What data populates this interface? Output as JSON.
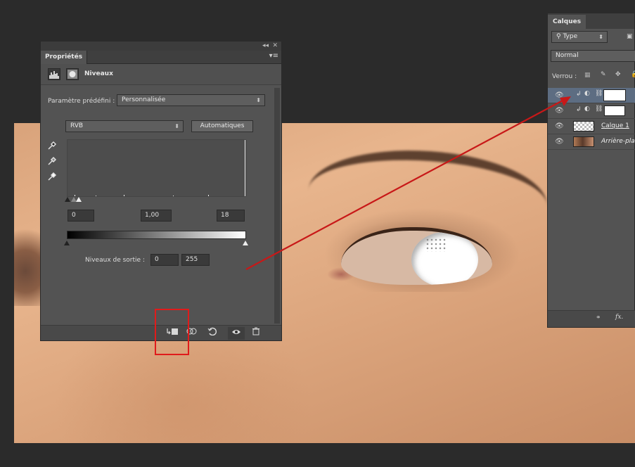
{
  "properties_panel": {
    "tab_label": "Propriétés",
    "collapse_glyph": "◂◂",
    "close_glyph": "✕",
    "menu_glyph": "▾≡",
    "adjustment_title": "Niveaux",
    "preset_label": "Paramètre prédéfini :",
    "preset_value": "Personnalisée",
    "channel_value": "RVB",
    "auto_button": "Automatiques",
    "input_black": "0",
    "input_gamma": "1,00",
    "input_white": "18",
    "output_label": "Niveaux de sortie :",
    "output_black": "0",
    "output_white": "255",
    "footer_icons": [
      "clip-to-layer-icon",
      "view-previous-icon",
      "reset-icon",
      "visibility-icon",
      "trash-icon"
    ]
  },
  "layers_panel": {
    "tab_label": "Calques",
    "filter_type": "Type",
    "blend_mode": "Normal",
    "lock_label": "Verrou :",
    "layers": [
      {
        "name": "",
        "type": "levels-adjustment",
        "selected": true
      },
      {
        "name": "",
        "type": "levels-adjustment",
        "selected": false
      },
      {
        "name": "Calque 1",
        "type": "pixel-layer",
        "selected": false
      },
      {
        "name": "Arrière-pla",
        "type": "background",
        "selected": false
      }
    ],
    "footer_link": "⚭",
    "footer_fx": "fx."
  },
  "colors": {
    "panel_bg": "#535353",
    "highlight_red": "#e01b1b",
    "selected_layer": "#5d6d82"
  }
}
